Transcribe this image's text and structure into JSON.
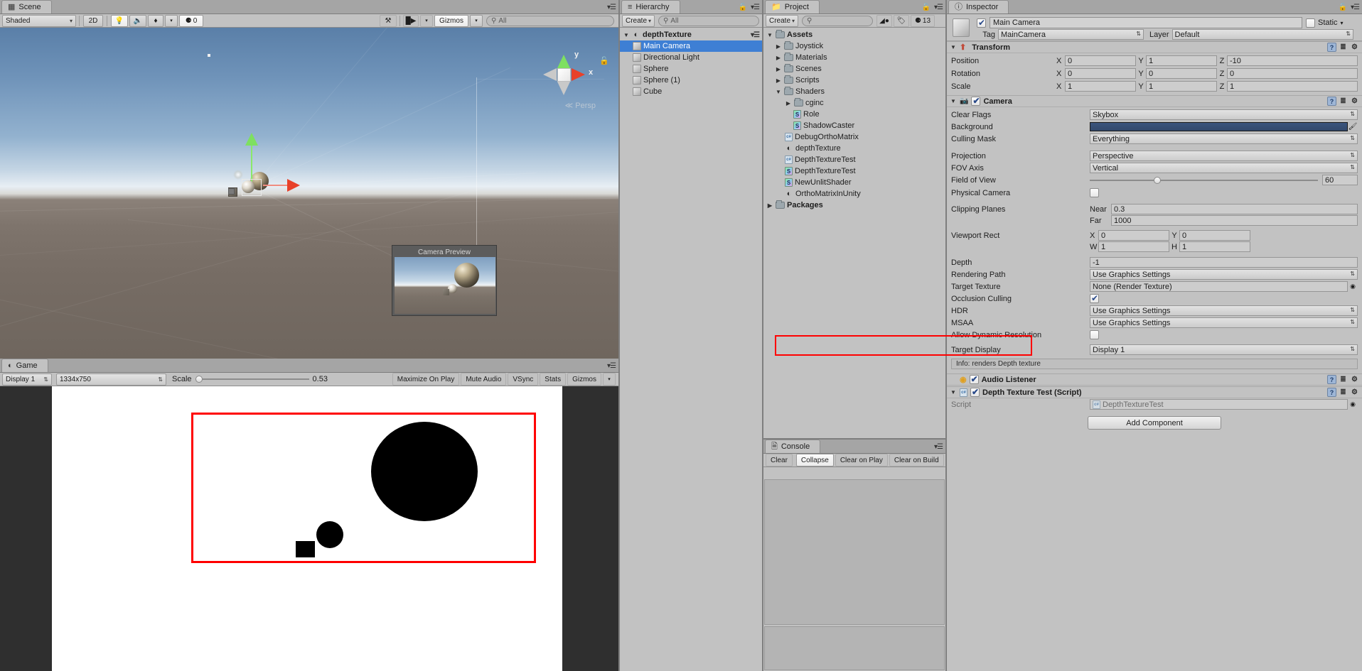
{
  "scene": {
    "tab_label": "Scene",
    "tab_icon": "scene-grid-icon",
    "toolbar": {
      "draw_mode": "Shaded",
      "mode_2d": "2D",
      "lighting_icon": "lightbulb-icon",
      "audio_icon": "speaker-icon",
      "fx_icon": "effects-icon",
      "hidden_count": "0",
      "hidden_icon": "eye-off-icon",
      "tools_icon": "tools-icon",
      "camera_icon": "camera-icon",
      "gizmos_label": "Gizmos",
      "search_placeholder": "All",
      "search_icon": "search-icon"
    },
    "gizmo": {
      "y_label": "y",
      "x_label": "x",
      "persp_label": "Persp",
      "persp_arrow": "≪",
      "lock_icon": "lock-open-icon"
    },
    "camera_preview_title": "Camera Preview"
  },
  "game": {
    "tab_label": "Game",
    "tab_icon": "game-pad-icon",
    "toolbar": {
      "display": "Display 1",
      "resolution": "1334x750",
      "scale_label": "Scale",
      "scale_value": "0.53",
      "maximize_on_play": "Maximize On Play",
      "mute_audio": "Mute Audio",
      "vsync": "VSync",
      "stats": "Stats",
      "gizmos": "Gizmos"
    }
  },
  "hierarchy": {
    "tab_label": "Hierarchy",
    "tab_icon": "hierarchy-icon",
    "create_label": "Create",
    "search_placeholder": "All",
    "scene_name": "depthTexture",
    "items": [
      {
        "label": "Main Camera",
        "icon": "cube-icon",
        "selected": true
      },
      {
        "label": "Directional Light",
        "icon": "cube-icon",
        "selected": false
      },
      {
        "label": "Sphere",
        "icon": "cube-icon",
        "selected": false
      },
      {
        "label": "Sphere (1)",
        "icon": "cube-icon",
        "selected": false
      },
      {
        "label": "Cube",
        "icon": "cube-icon",
        "selected": false
      }
    ]
  },
  "project": {
    "tab_label": "Project",
    "tab_icon": "folder-icon",
    "create_label": "Create",
    "search_placeholder": "",
    "favorites_icon": "shapes-icon",
    "label_icon": "tag-icon",
    "hidden_icon": "eye-off-icon",
    "hidden_count": "13",
    "tree": [
      {
        "label": "Assets",
        "icon": "folder-icon",
        "depth": 0,
        "arrow": "down",
        "bold": true
      },
      {
        "label": "Joystick",
        "icon": "folder-icon",
        "depth": 1,
        "arrow": "right",
        "bold": false
      },
      {
        "label": "Materials",
        "icon": "folder-icon",
        "depth": 1,
        "arrow": "right",
        "bold": false
      },
      {
        "label": "Scenes",
        "icon": "folder-icon",
        "depth": 1,
        "arrow": "right",
        "bold": false
      },
      {
        "label": "Scripts",
        "icon": "folder-icon",
        "depth": 1,
        "arrow": "right",
        "bold": false
      },
      {
        "label": "Shaders",
        "icon": "folder-icon",
        "depth": 1,
        "arrow": "down",
        "bold": false
      },
      {
        "label": "cginc",
        "icon": "folder-icon",
        "depth": 2,
        "arrow": "right",
        "bold": false
      },
      {
        "label": "Role",
        "icon": "shader-icon",
        "depth": 3,
        "arrow": "blank",
        "bold": false
      },
      {
        "label": "ShadowCaster",
        "icon": "shader-icon",
        "depth": 3,
        "arrow": "blank",
        "bold": false
      },
      {
        "label": "DebugOrthoMatrix",
        "icon": "csharp-icon",
        "depth": 2,
        "arrow": "blank",
        "bold": false
      },
      {
        "label": "depthTexture",
        "icon": "unity-scene-icon",
        "depth": 2,
        "arrow": "blank",
        "bold": false
      },
      {
        "label": "DepthTextureTest",
        "icon": "csharp-icon",
        "depth": 2,
        "arrow": "blank",
        "bold": false
      },
      {
        "label": "DepthTextureTest",
        "icon": "shader-icon",
        "depth": 2,
        "arrow": "blank",
        "bold": false
      },
      {
        "label": "NewUnlitShader",
        "icon": "shader-icon",
        "depth": 2,
        "arrow": "blank",
        "bold": false
      },
      {
        "label": "OrthoMatrixInUnity",
        "icon": "unity-scene-icon",
        "depth": 2,
        "arrow": "blank",
        "bold": false
      },
      {
        "label": "Packages",
        "icon": "folder-icon",
        "depth": 0,
        "arrow": "right",
        "bold": true
      }
    ]
  },
  "console": {
    "tab_label": "Console",
    "tab_icon": "console-icon",
    "buttons": [
      "Clear",
      "Collapse",
      "Clear on Play",
      "Clear on Build"
    ]
  },
  "inspector": {
    "tab_label": "Inspector",
    "tab_icon": "info-icon",
    "object_name": "Main Camera",
    "object_enabled": true,
    "static_label": "Static",
    "tag_label": "Tag",
    "tag_value": "MainCamera",
    "layer_label": "Layer",
    "layer_value": "Default",
    "transform": {
      "title": "Transform",
      "rows": [
        {
          "label": "Position",
          "x": "0",
          "y": "1",
          "z": "-10"
        },
        {
          "label": "Rotation",
          "x": "0",
          "y": "0",
          "z": "0"
        },
        {
          "label": "Scale",
          "x": "1",
          "y": "1",
          "z": "1"
        }
      ],
      "axis_labels": [
        "X",
        "Y",
        "Z"
      ]
    },
    "camera": {
      "title": "Camera",
      "enabled": true,
      "clear_flags_label": "Clear Flags",
      "clear_flags_value": "Skybox",
      "background_label": "Background",
      "background_color": "#37507a",
      "eyedropper_icon": "eyedropper-icon",
      "culling_mask_label": "Culling Mask",
      "culling_mask_value": "Everything",
      "projection_label": "Projection",
      "projection_value": "Perspective",
      "fov_axis_label": "FOV Axis",
      "fov_axis_value": "Vertical",
      "field_of_view_label": "Field of View",
      "field_of_view_value": "60",
      "physical_camera_label": "Physical Camera",
      "physical_camera_checked": false,
      "clipping_planes_label": "Clipping Planes",
      "near_label": "Near",
      "near_value": "0.3",
      "far_label": "Far",
      "far_value": "1000",
      "viewport_rect_label": "Viewport Rect",
      "viewport": {
        "x_label": "X",
        "x": "0",
        "y_label": "Y",
        "y": "0",
        "w_label": "W",
        "w": "1",
        "h_label": "H",
        "h": "1"
      },
      "depth_label": "Depth",
      "depth_value": "-1",
      "rendering_path_label": "Rendering Path",
      "rendering_path_value": "Use Graphics Settings",
      "target_texture_label": "Target Texture",
      "target_texture_value": "None (Render Texture)",
      "occlusion_culling_label": "Occlusion Culling",
      "occlusion_culling_checked": true,
      "hdr_label": "HDR",
      "hdr_value": "Use Graphics Settings",
      "msaa_label": "MSAA",
      "msaa_value": "Use Graphics Settings",
      "allow_dynamic_resolution_label": "Allow Dynamic Resolution",
      "allow_dynamic_resolution_checked": false,
      "target_display_label": "Target Display",
      "target_display_value": "Display 1",
      "info_text": "Info: renders Depth texture"
    },
    "audio_listener": {
      "title": "Audio Listener",
      "enabled": true,
      "icon": "audio-listener-icon"
    },
    "script_component": {
      "title": "Depth Texture Test (Script)",
      "enabled": true,
      "script_label": "Script",
      "script_value": "DepthTextureTest",
      "icon": "csharp-icon",
      "highlight_color": "#ff0000"
    },
    "add_component_label": "Add Component"
  }
}
